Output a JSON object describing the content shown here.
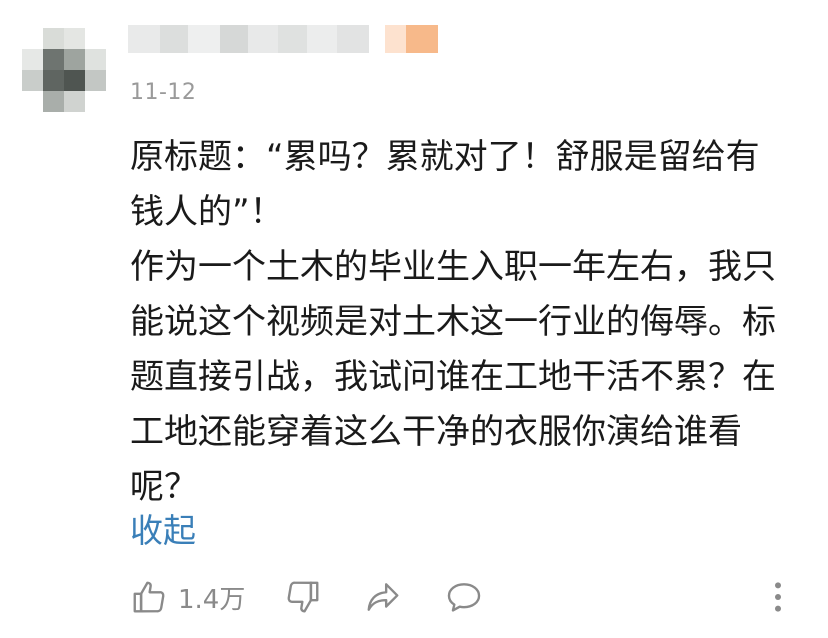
{
  "comment": {
    "date": "11-12",
    "lines": [
      "原标题：“累吗？累就对了！舒服是留给有",
      "钱人的”！",
      "作为一个土木的毕业生入职一年左右，我只",
      "能说这个视频是对土木这一行业的侮辱。标",
      "题直接引战，我试问谁在工地干活不累？在",
      "工地还能穿着这么干净的衣服你演给谁看",
      "呢？"
    ],
    "collapse_label": "收起"
  },
  "actions": {
    "like_count": "1.4万",
    "icons": [
      "thumbs-up-icon",
      "thumbs-down-icon",
      "share-icon",
      "comment-icon",
      "more-icon"
    ]
  },
  "colors": {
    "text": "#1a1a1a",
    "date": "#9a9a9a",
    "link": "#3a7fb8",
    "icon": "#8a8a8a"
  }
}
